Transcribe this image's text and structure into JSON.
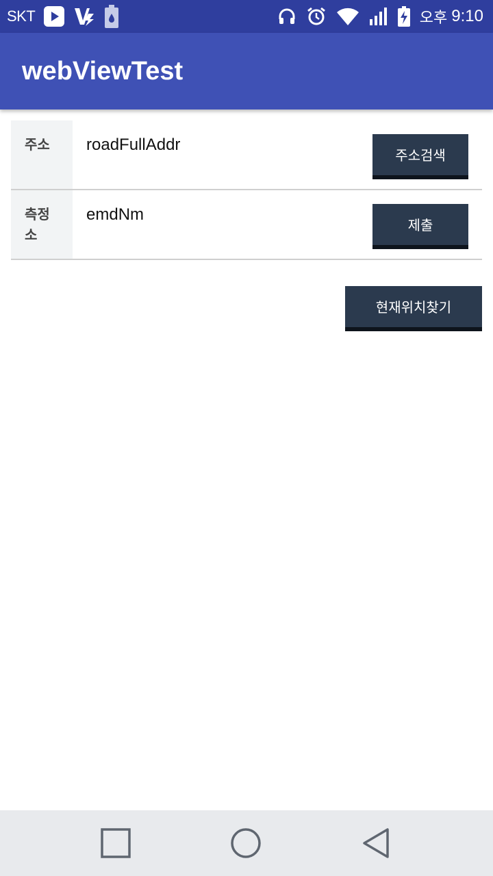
{
  "status_bar": {
    "carrier": "SKT",
    "ampm": "오후",
    "time": "9:10"
  },
  "app_bar": {
    "title": "webViewTest"
  },
  "form": {
    "rows": [
      {
        "label": "주소",
        "value": "roadFullAddr",
        "button": "주소검색"
      },
      {
        "label": "측정\n소",
        "value": "emdNm",
        "button": "제출"
      }
    ]
  },
  "location_button": "현재위치찾기",
  "colors": {
    "status_bar": "#2f3e9e",
    "app_bar": "#3f51b5",
    "button": "#2b3a4e",
    "label_bg": "#f2f4f5",
    "nav_bar": "#e8eaed"
  },
  "nav_icons": [
    "recent-apps-icon",
    "home-icon",
    "back-icon"
  ]
}
